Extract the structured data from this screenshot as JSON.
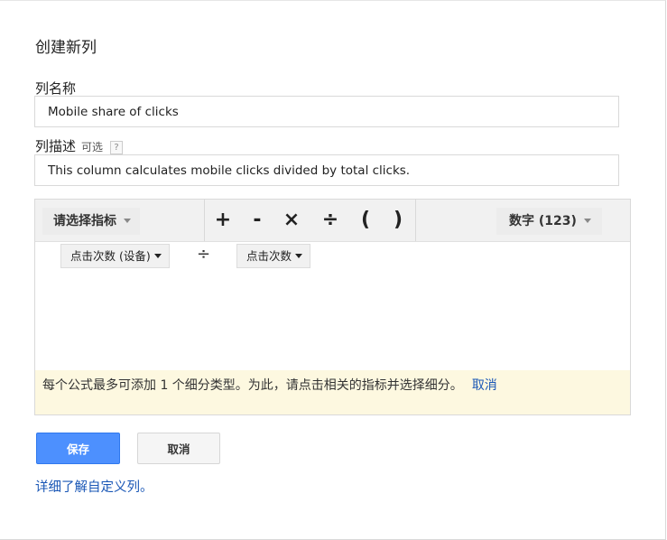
{
  "dialog": {
    "title": "创建新列"
  },
  "name_field": {
    "label": "列名称",
    "value": "Mobile share of clicks"
  },
  "description_field": {
    "label": "列描述",
    "optional": "可选",
    "help": "?",
    "value": "This column calculates mobile clicks divided by total clicks."
  },
  "toolbar": {
    "metric_select": "请选择指标",
    "operators": {
      "plus": "+",
      "minus": "-",
      "times": "×",
      "divide": "÷",
      "open_paren": "(",
      "close_paren": ")"
    },
    "number_select": "数字 (123)"
  },
  "formula": {
    "left_metric": "点击次数 (设备)",
    "operator": "÷",
    "right_metric": "点击次数"
  },
  "notice": {
    "text": "每个公式最多可添加 1 个细分类型。为此，请点击相关的指标并选择细分。",
    "link": "取消"
  },
  "actions": {
    "save": "保存",
    "cancel": "取消"
  },
  "learn_more": "详细了解自定义列。",
  "colors": {
    "primary": "#4d90fe",
    "link": "#1a57b6",
    "notice_bg": "#fdf8e0"
  }
}
